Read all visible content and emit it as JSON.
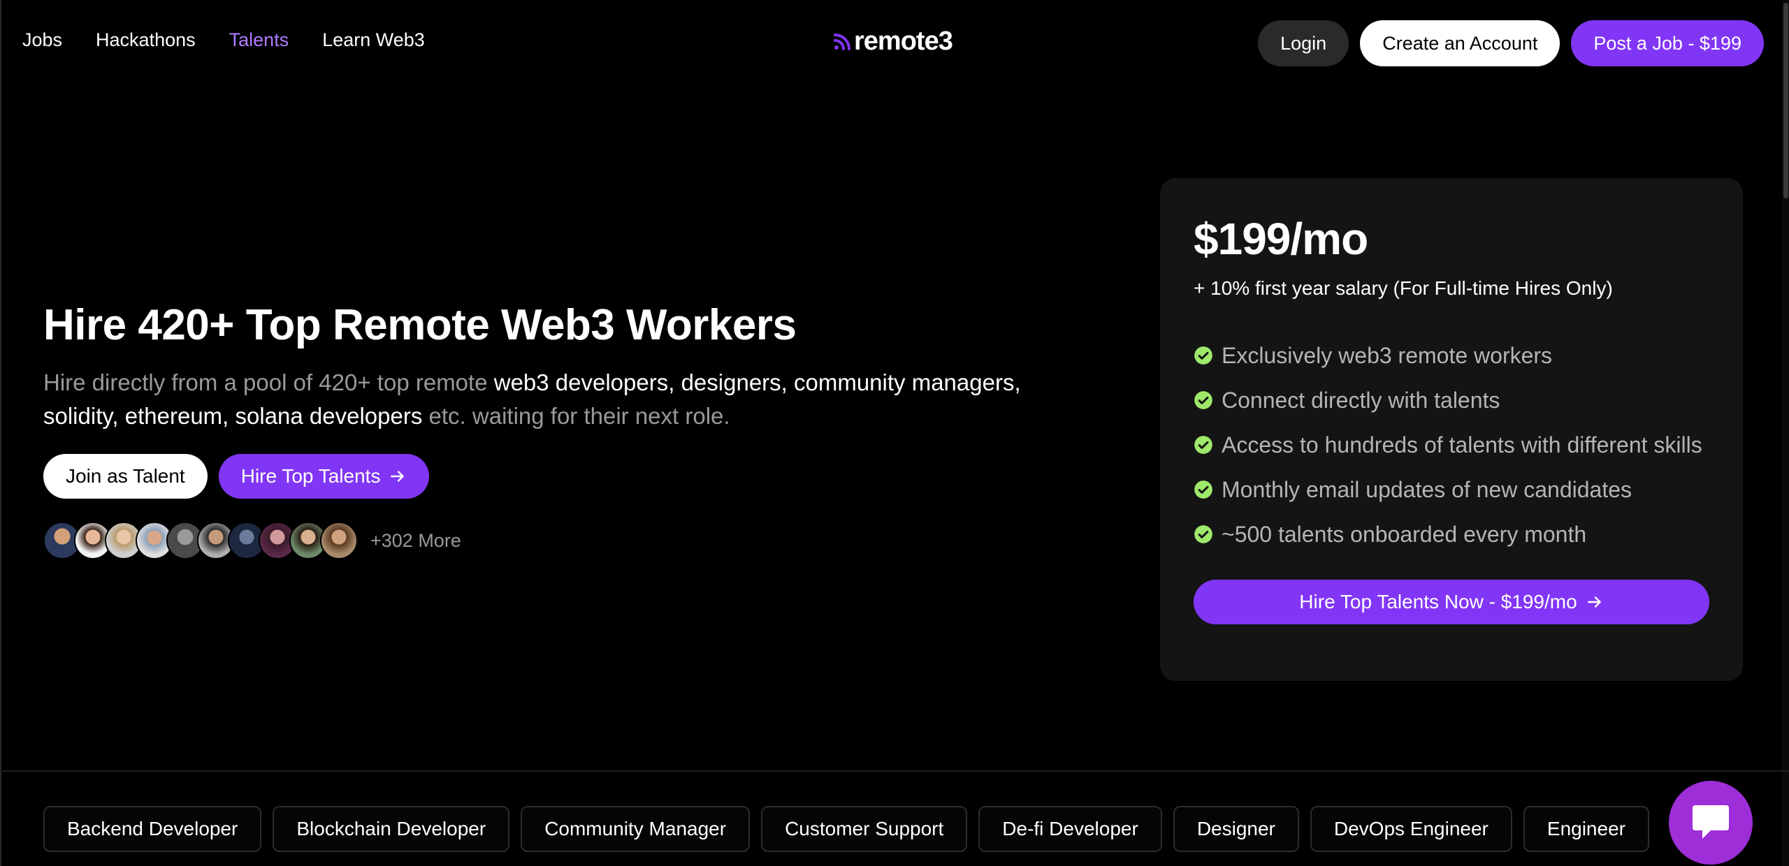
{
  "nav": {
    "links": [
      {
        "label": "Jobs",
        "active": false
      },
      {
        "label": "Hackathons",
        "active": false
      },
      {
        "label": "Talents",
        "active": true
      },
      {
        "label": "Learn Web3",
        "active": false
      }
    ],
    "logo_text": "remote3",
    "login": "Login",
    "create_account": "Create an Account",
    "post_job": "Post a Job - $199"
  },
  "hero": {
    "title": "Hire 420+ Top Remote Web3 Workers",
    "subtitle_part1": "Hire directly from a pool of 420+ top remote ",
    "subtitle_highlight": "web3 developers, designers, community managers, solidity, ethereum, solana developers",
    "subtitle_part2": " etc. waiting for their next role.",
    "join_talent": "Join as Talent",
    "hire_talents": "Hire Top Talents",
    "more_count": "+302 More"
  },
  "pricing": {
    "price": "$199/mo",
    "note": "+ 10% first year salary (For Full-time Hires Only)",
    "features": [
      "Exclusively web3 remote workers",
      "Connect directly with talents",
      "Access to hundreds of talents with different skills",
      "Monthly email updates of new candidates",
      "~500 talents onboarded every month"
    ],
    "cta": "Hire Top Talents Now - $199/mo"
  },
  "categories": [
    "Backend Developer",
    "Blockchain Developer",
    "Community Manager",
    "Customer Support",
    "De-fi Developer",
    "Designer",
    "DevOps Engineer",
    "Engineer"
  ],
  "colors": {
    "accent": "#8236f5",
    "active_link": "#b07cff",
    "check_green": "#9ee86a",
    "chat_button": "#9d2ed8",
    "card_bg": "#141414"
  },
  "icons": {
    "arrow": "arrow-right-icon",
    "check": "check-circle-icon",
    "chat": "chat-icon",
    "logo": "signal-icon"
  }
}
